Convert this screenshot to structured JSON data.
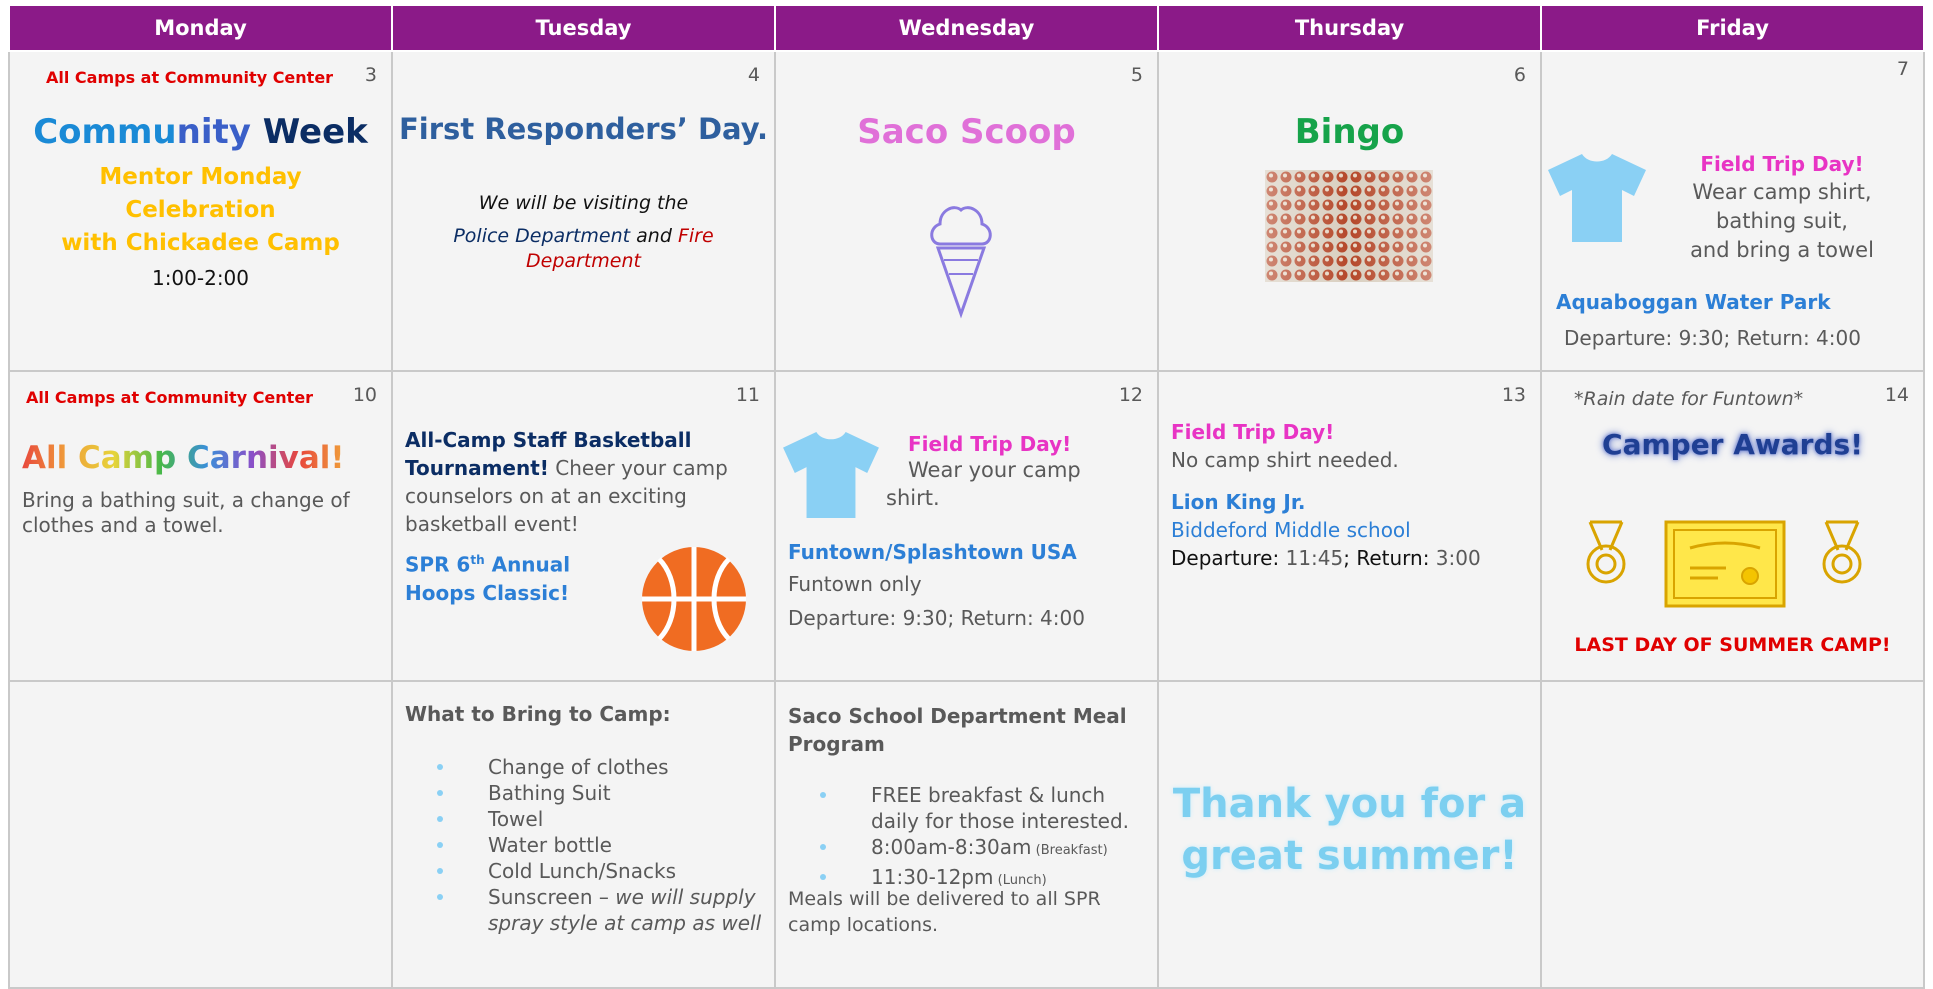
{
  "days": [
    "Monday",
    "Tuesday",
    "Wednesday",
    "Thursday",
    "Friday"
  ],
  "week1": {
    "mon": {
      "num": "3",
      "note": "All Camps at Community Center",
      "title_a": "Commu",
      "title_b": "nity",
      "title_c": " Week",
      "sub1": "Mentor Monday",
      "sub2": "Celebration",
      "sub3": "with Chickadee Camp",
      "time": "1:00-2:00"
    },
    "tue": {
      "num": "4",
      "title": "First Responders’ Day.",
      "line1": "We will be visiting the",
      "police": "Police Department",
      "and": " and ",
      "fire": "Fire",
      "dept": "Department"
    },
    "wed": {
      "num": "5",
      "title": "Saco Scoop",
      "icon": "ice-cream-cone"
    },
    "thu": {
      "num": "6",
      "title": "Bingo",
      "image": "bingo-balls"
    },
    "fri": {
      "num": "7",
      "trip": "Field Trip Day!",
      "l1": "Wear camp shirt,",
      "l2": "bathing suit,",
      "l3": "and bring a towel",
      "park": "Aquaboggan Water Park",
      "times": "Departure: 9:30; Return: 4:00",
      "icon": "t-shirt"
    }
  },
  "week2": {
    "mon": {
      "num": "10",
      "note": "All Camps at Community Center",
      "title": "All Camp Carnival!",
      "body": "Bring a bathing suit, a change of clothes and a towel."
    },
    "tue": {
      "num": "11",
      "t1": "All-Camp Staff Basketball",
      "t2": "Tournament!",
      "body": " Cheer your camp counselors on at an exciting basketball event!",
      "spr1": "SPR 6",
      "sup": "th",
      "spr2": " Annual",
      "spr3": "Hoops Classic!",
      "icon": "basketball"
    },
    "wed": {
      "num": "12",
      "trip": "Field Trip Day!",
      "l1": "Wear your camp",
      "l2": "shirt.",
      "place": "Funtown/Splashtown USA",
      "only": "Funtown only",
      "times": "Departure: 9:30; Return: 4:00",
      "icon": "t-shirt"
    },
    "thu": {
      "num": "13",
      "trip": "Field Trip Day!",
      "noshirt": "No camp shirt needed.",
      "show": "Lion King Jr.",
      "school": "Biddeford Middle school",
      "dep": "Departure: ",
      "dept": "11:45",
      "ret": "; Return: ",
      "rett": "3:00"
    },
    "fri": {
      "num": "14",
      "rain": "*Rain date for Funtown*",
      "awards": "Camper Awards!",
      "last": "LAST DAY OF SUMMER CAMP!",
      "icons": [
        "medal",
        "certificate",
        "medal"
      ]
    }
  },
  "week3": {
    "tue": {
      "title": "What to Bring to Camp:",
      "items": [
        "Change of clothes",
        "Bathing Suit",
        "Towel",
        "Water bottle",
        "Cold Lunch/Snacks"
      ],
      "sun": "Sunscreen – ",
      "sun_i": "we will supply spray style at camp as well"
    },
    "wed": {
      "title": "Saco School Department Meal Program",
      "i1": "FREE breakfast & lunch daily for those interested.",
      "i2": "8:00am-8:30am",
      "i2s": " (Breakfast)",
      "i3": "11:30-12pm",
      "i3s": " (Lunch)",
      "foot": "Meals will be delivered to all SPR camp locations."
    },
    "thu": {
      "l1": "Thank you for a",
      "l2": "great summer!"
    }
  },
  "colors": {
    "header": "#8b1a88",
    "magenta": "#e834c4",
    "blue": "#2c7fd6",
    "navy": "#0b2d64",
    "gold": "#ffc000",
    "red": "#e00000",
    "green": "#16a34a",
    "shirt": "#8ad0f4"
  }
}
